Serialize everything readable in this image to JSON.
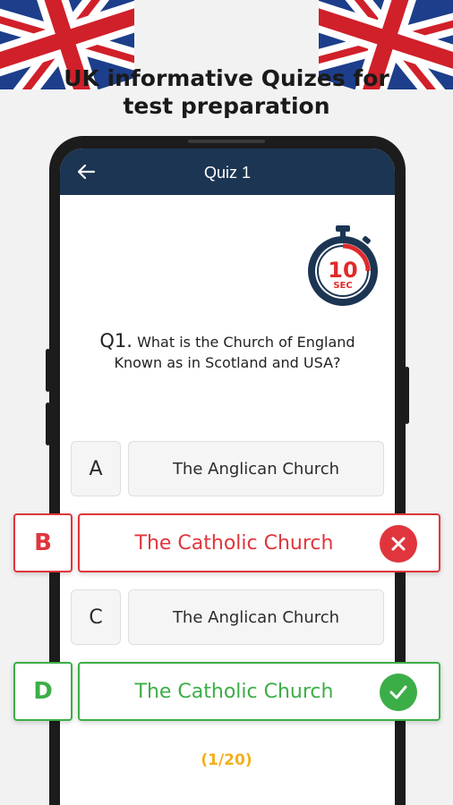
{
  "promo": {
    "title_line1": "UK informative Quizes for",
    "title_line2": "test preparation"
  },
  "appbar": {
    "title": "Quiz 1",
    "back_icon": "arrow-left-icon"
  },
  "timer": {
    "value": "10",
    "unit": "SEC",
    "icon": "stopwatch-icon"
  },
  "question": {
    "number": "Q1.",
    "text": "What is the Church of England Known as in Scotland and USA?"
  },
  "options": [
    {
      "letter": "A",
      "text": "The Anglican Church",
      "state": "default"
    },
    {
      "letter": "B",
      "text": "The Catholic Church",
      "state": "wrong",
      "icon": "close-icon"
    },
    {
      "letter": "C",
      "text": "The Anglican Church",
      "state": "default"
    },
    {
      "letter": "D",
      "text": "The Catholic Church",
      "state": "correct",
      "icon": "check-icon"
    }
  ],
  "progress": {
    "label": "(1/20)"
  },
  "colors": {
    "appbar": "#1c3553",
    "wrong": "#e0353c",
    "correct": "#3cae47",
    "counter": "#f2b01e",
    "timer_red": "#e02a2a",
    "timer_navy": "#1c3553"
  }
}
